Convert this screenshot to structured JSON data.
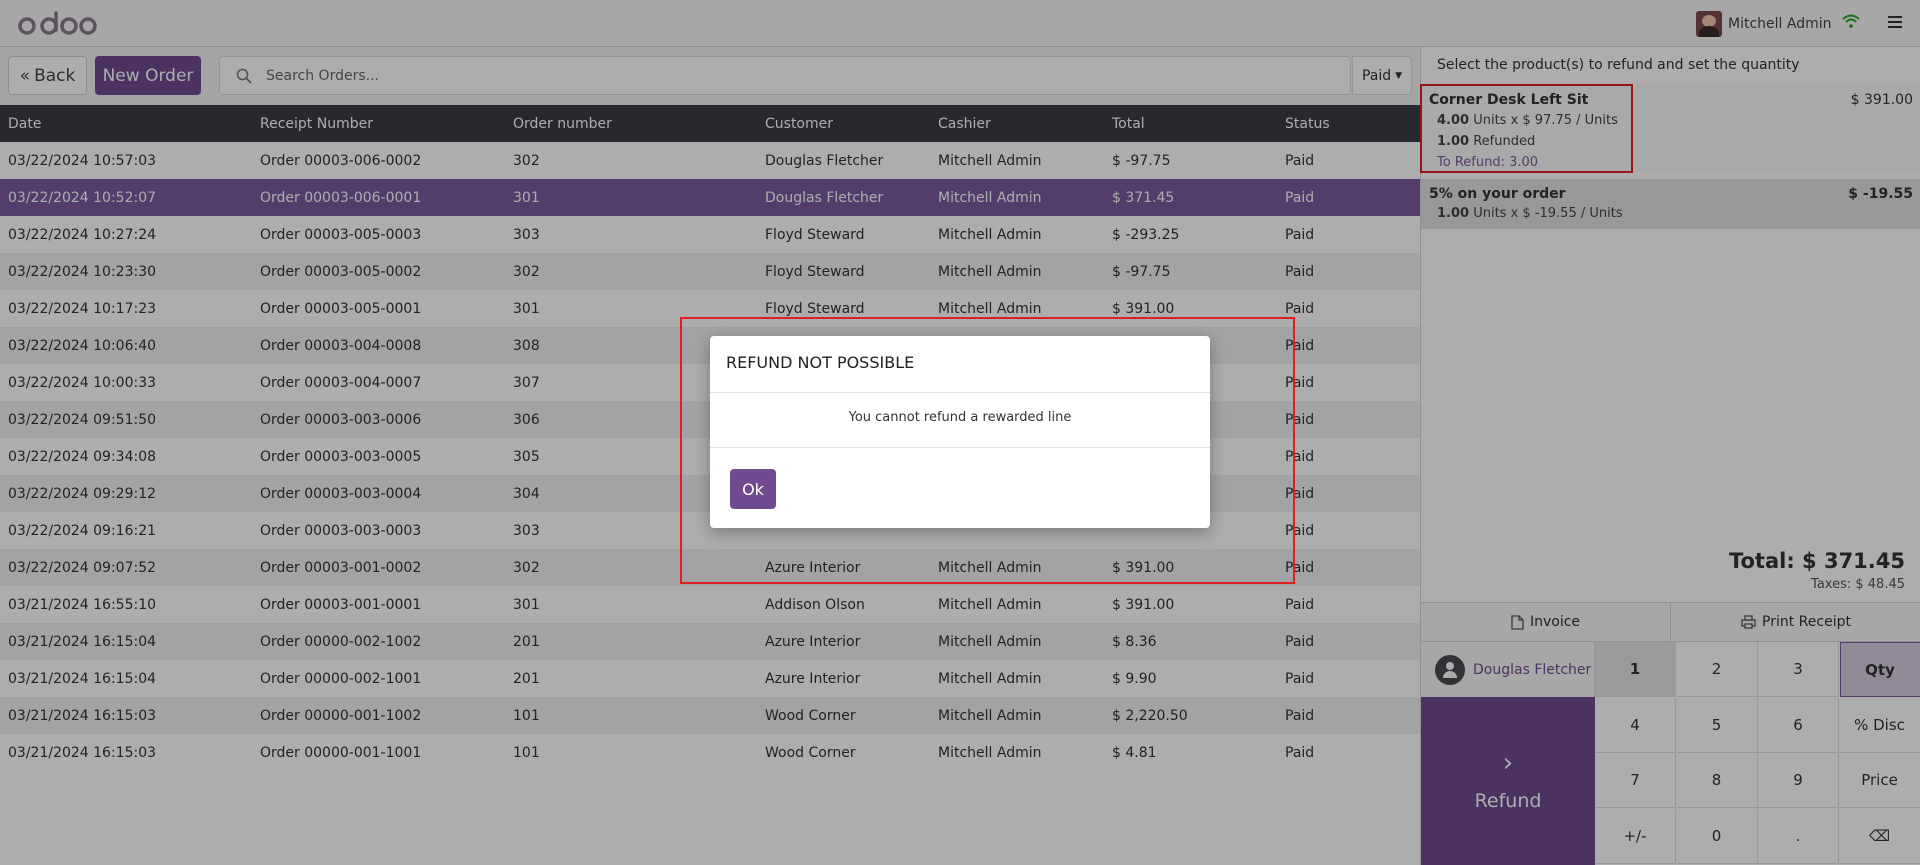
{
  "app": {
    "logo_text": "odoo"
  },
  "user": {
    "name": "Mitchell Admin"
  },
  "toolbar": {
    "back_label": "Back",
    "new_order_label": "New Order",
    "search_placeholder": "Search Orders...",
    "filter_label": "Paid"
  },
  "table": {
    "headers": [
      "Date",
      "Receipt Number",
      "Order number",
      "Customer",
      "Cashier",
      "Total",
      "Status"
    ],
    "rows": [
      [
        "03/22/2024 10:57:03",
        "Order 00003-006-0002",
        "302",
        "Douglas Fletcher",
        "Mitchell Admin",
        "$ -97.75",
        "Paid"
      ],
      [
        "03/22/2024 10:52:07",
        "Order 00003-006-0001",
        "301",
        "Douglas Fletcher",
        "Mitchell Admin",
        "$ 371.45",
        "Paid"
      ],
      [
        "03/22/2024 10:27:24",
        "Order 00003-005-0003",
        "303",
        "Floyd Steward",
        "Mitchell Admin",
        "$ -293.25",
        "Paid"
      ],
      [
        "03/22/2024 10:23:30",
        "Order 00003-005-0002",
        "302",
        "Floyd Steward",
        "Mitchell Admin",
        "$ -97.75",
        "Paid"
      ],
      [
        "03/22/2024 10:17:23",
        "Order 00003-005-0001",
        "301",
        "Floyd Steward",
        "Mitchell Admin",
        "$ 391.00",
        "Paid"
      ],
      [
        "03/22/2024 10:06:40",
        "Order 00003-004-0008",
        "308",
        "",
        "",
        "",
        "Paid"
      ],
      [
        "03/22/2024 10:00:33",
        "Order 00003-004-0007",
        "307",
        "",
        "",
        "",
        "Paid"
      ],
      [
        "03/22/2024 09:51:50",
        "Order 00003-003-0006",
        "306",
        "",
        "",
        "",
        "Paid"
      ],
      [
        "03/22/2024 09:34:08",
        "Order 00003-003-0005",
        "305",
        "",
        "",
        "",
        "Paid"
      ],
      [
        "03/22/2024 09:29:12",
        "Order 00003-003-0004",
        "304",
        "",
        "",
        "",
        "Paid"
      ],
      [
        "03/22/2024 09:16:21",
        "Order 00003-003-0003",
        "303",
        "",
        "",
        "",
        "Paid"
      ],
      [
        "03/22/2024 09:07:52",
        "Order 00003-001-0002",
        "302",
        "Azure Interior",
        "Mitchell Admin",
        "$ 391.00",
        "Paid"
      ],
      [
        "03/21/2024 16:55:10",
        "Order 00003-001-0001",
        "301",
        "Addison Olson",
        "Mitchell Admin",
        "$ 391.00",
        "Paid"
      ],
      [
        "03/21/2024 16:15:04",
        "Order 00000-002-1002",
        "201",
        "Azure Interior",
        "Mitchell Admin",
        "$ 8.36",
        "Paid"
      ],
      [
        "03/21/2024 16:15:04",
        "Order 00000-002-1001",
        "201",
        "Azure Interior",
        "Mitchell Admin",
        "$ 9.90",
        "Paid"
      ],
      [
        "03/21/2024 16:15:03",
        "Order 00000-001-1002",
        "101",
        "Wood Corner",
        "Mitchell Admin",
        "$ 2,220.50",
        "Paid"
      ],
      [
        "03/21/2024 16:15:03",
        "Order 00000-001-1001",
        "101",
        "Wood Corner",
        "Mitchell Admin",
        "$ 4.81",
        "Paid"
      ]
    ],
    "selected_row": 1
  },
  "order": {
    "header": "Select the product(s) to refund and set the quantity",
    "line1": {
      "name": "Corner Desk Left Sit",
      "price": "$ 391.00",
      "qty": "4.00",
      "qty_detail": " Units x $ 97.75 / Units",
      "refunded_qty": "1.00",
      "refunded_label": " Refunded",
      "to_refund": "To Refund: 3.00"
    },
    "line2": {
      "name": "5% on your order",
      "price": "$ -19.55",
      "qty": "1.00",
      "qty_detail": " Units x $ -19.55 / Units"
    },
    "total": "Total: $ 371.45",
    "taxes": "Taxes: $ 48.45"
  },
  "actions": {
    "invoice_label": "Invoice",
    "print_label": "Print Receipt"
  },
  "customer": {
    "name": "Douglas Fletcher"
  },
  "refund_label": "Refund",
  "numpad": {
    "keys": [
      "1",
      "2",
      "3",
      "Qty",
      "4",
      "5",
      "6",
      "% Disc",
      "7",
      "8",
      "9",
      "Price",
      "+/-",
      "0",
      ".",
      "⌫"
    ]
  },
  "dialog": {
    "title": "REFUND NOT POSSIBLE",
    "message": "You cannot refund a rewarded line",
    "ok_label": "Ok"
  },
  "colors": {
    "brand": "#6f4a8e",
    "highlight": "#e02020"
  }
}
